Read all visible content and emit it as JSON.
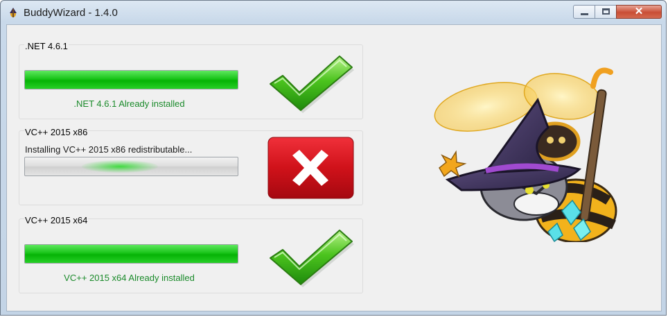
{
  "window": {
    "title": "BuddyWizard - 1.4.0"
  },
  "title_controls": {
    "minimize": "minimize-icon",
    "maximize": "maximize-icon",
    "close": "close-icon"
  },
  "components": [
    {
      "group_title": ".NET 4.6.1",
      "status_text": ".NET 4.6.1 Already installed",
      "progress": 1.0,
      "state": "installed",
      "icon": "checkmark-icon"
    },
    {
      "group_title": "VC++ 2015 x86",
      "status_text": "Installing VC++ 2015 x86 redistributable...",
      "progress": null,
      "state": "installing",
      "icon": "error-cross-icon"
    },
    {
      "group_title": "VC++ 2015 x64",
      "status_text": "VC++ 2015 x64 Already installed",
      "progress": 1.0,
      "state": "installed",
      "icon": "checkmark-icon"
    }
  ],
  "mascot": "wizard-bee-mascot-illustration",
  "colors": {
    "success_text": "#1a8a2a",
    "progress_green": "#0cbb0c",
    "error_red": "#d0121a",
    "close_button": "#c94e35"
  }
}
